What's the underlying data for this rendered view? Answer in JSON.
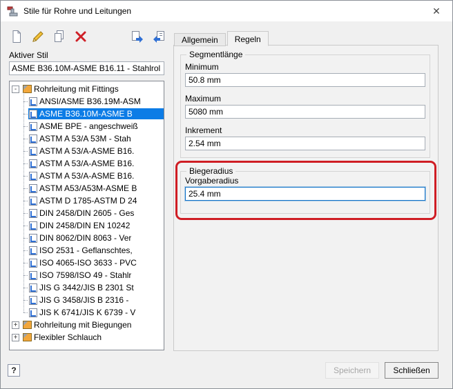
{
  "window": {
    "title": "Stile für Rohre und Leitungen",
    "close_glyph": "✕"
  },
  "toolbar": {
    "icons": [
      "new-style-icon",
      "edit-style-icon",
      "copy-style-icon",
      "delete-style-icon",
      "save-to-library-icon",
      "load-from-library-icon"
    ]
  },
  "active_style": {
    "label": "Aktiver Stil",
    "value": "ASME B36.10M-ASME B16.11 - Stahlrol"
  },
  "tree": {
    "groups": [
      {
        "label": "Rohrleitung mit Fittings",
        "toggle": "-",
        "expanded": true,
        "children": [
          {
            "label": "ANSI/ASME B36.19M-ASM"
          },
          {
            "label": "ASME B36.10M-ASME B",
            "selected": true
          },
          {
            "label": "ASME BPE - angeschweiß"
          },
          {
            "label": "ASTM A 53/A 53M - Stah"
          },
          {
            "label": "ASTM A 53/A-ASME B16."
          },
          {
            "label": "ASTM A 53/A-ASME B16."
          },
          {
            "label": "ASTM A 53/A-ASME B16."
          },
          {
            "label": "ASTM A53/A53M-ASME B"
          },
          {
            "label": "ASTM D 1785-ASTM D 24"
          },
          {
            "label": "DIN 2458/DIN 2605 - Ges"
          },
          {
            "label": "DIN 2458/DIN EN 10242"
          },
          {
            "label": "DIN 8062/DIN 8063 - Ver"
          },
          {
            "label": "ISO 2531 - Geflanschtes,"
          },
          {
            "label": "ISO 4065-ISO 3633 - PVC"
          },
          {
            "label": "ISO 7598/ISO 49 - Stahlr"
          },
          {
            "label": "JIS G 3442/JIS B 2301 St"
          },
          {
            "label": "JIS G 3458/JIS B 2316 -"
          },
          {
            "label": "JIS K 6741/JIS K 6739 - V"
          }
        ]
      },
      {
        "label": "Rohrleitung mit Biegungen",
        "toggle": "+",
        "expanded": false,
        "children": []
      },
      {
        "label": "Flexibler Schlauch",
        "toggle": "+",
        "expanded": false,
        "children": []
      }
    ]
  },
  "tabs": [
    {
      "label": "Allgemein",
      "active": false
    },
    {
      "label": "Regeln",
      "active": true
    }
  ],
  "rules": {
    "segment_group": {
      "title": "Segmentlänge",
      "fields": [
        {
          "label": "Minimum",
          "value": "50.8 mm"
        },
        {
          "label": "Maximum",
          "value": "5080 mm"
        },
        {
          "label": "Inkrement",
          "value": "2.54 mm"
        }
      ]
    },
    "bend_group": {
      "title": "Biegeradius",
      "field": {
        "label": "Vorgaberadius",
        "value": "25.4 mm",
        "focused": true
      }
    }
  },
  "footer": {
    "help_glyph": "?",
    "save_label": "Speichern",
    "save_enabled": false,
    "close_label": "Schließen"
  },
  "annotation": {
    "type": "highlight-box",
    "color": "#cf1d24",
    "target": "Biegeradius group"
  },
  "colors": {
    "selection": "#0c7ce6",
    "focus_border": "#1273c8",
    "annotation": "#cf1d24"
  }
}
